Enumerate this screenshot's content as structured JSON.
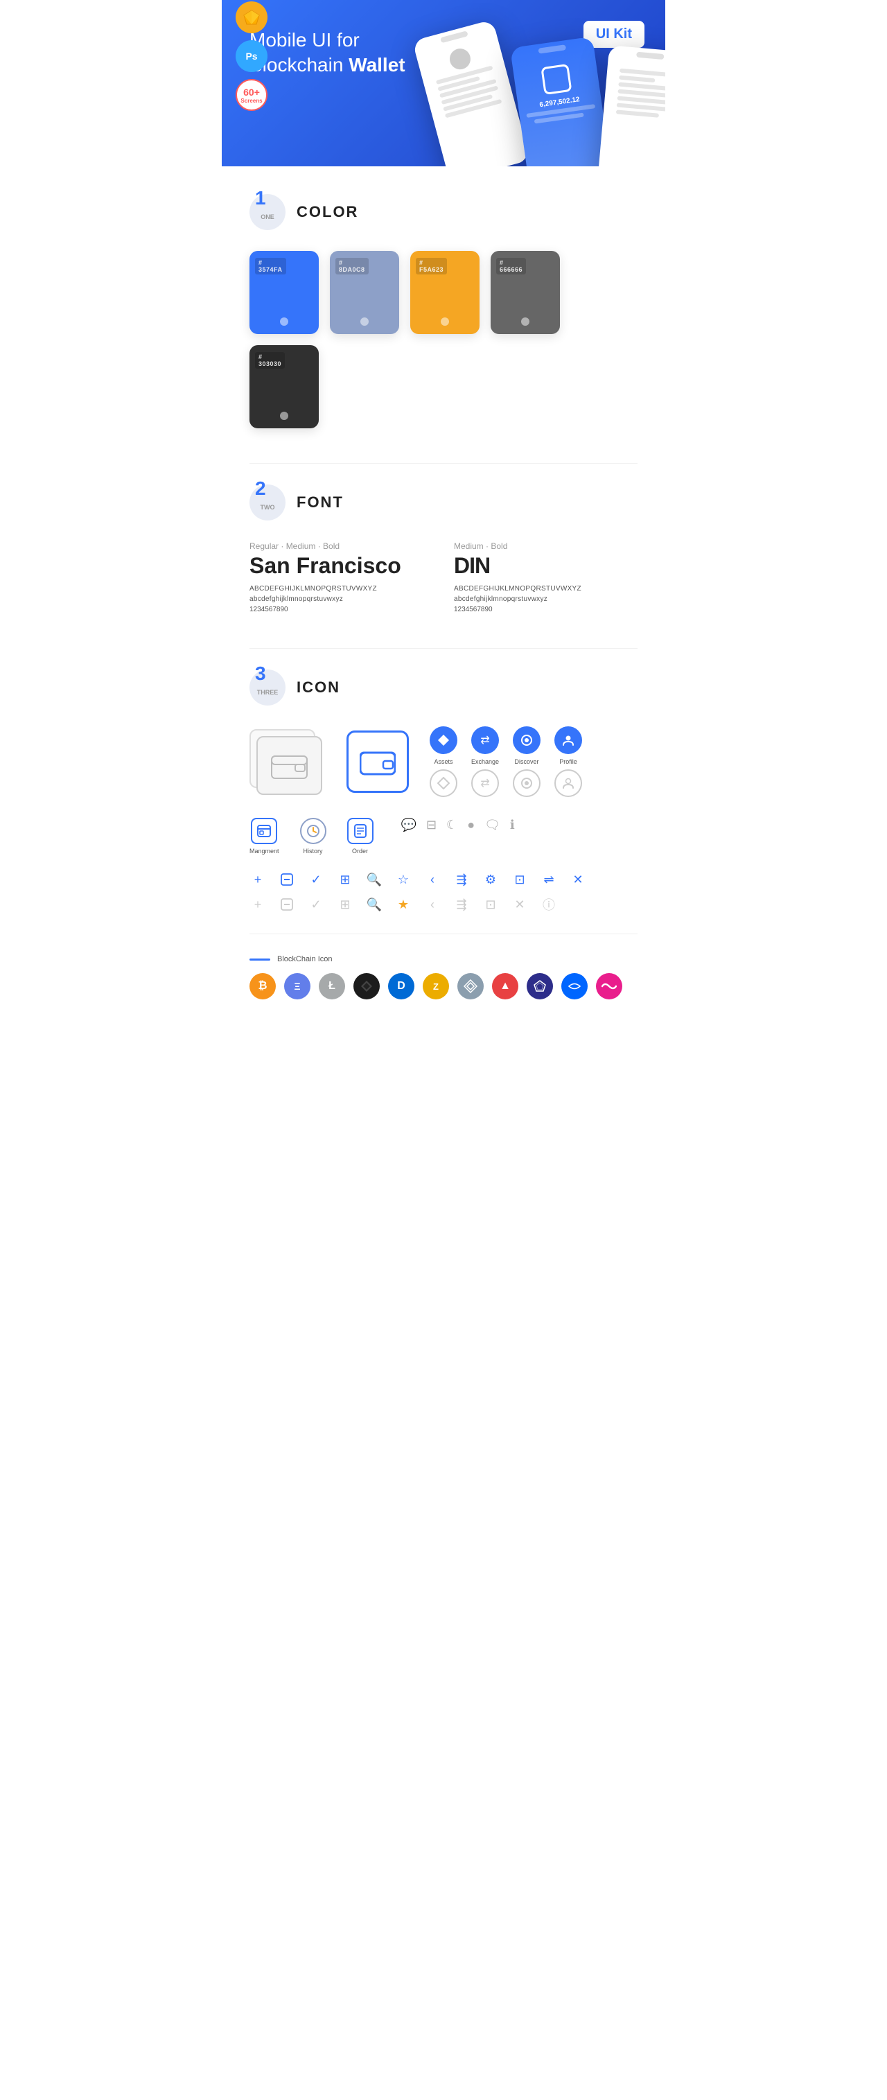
{
  "hero": {
    "title_regular": "Mobile UI for Blockchain ",
    "title_bold": "Wallet",
    "badge": "UI Kit",
    "badges": [
      {
        "id": "sketch",
        "symbol": "⬡",
        "label": "Sketch"
      },
      {
        "id": "ps",
        "symbol": "Ps",
        "label": "Photoshop"
      },
      {
        "id": "screens",
        "num": "60+",
        "label": "Screens"
      }
    ]
  },
  "sections": {
    "color": {
      "number": "1",
      "word": "ONE",
      "title": "COLOR",
      "swatches": [
        {
          "hex": "#3574FA",
          "label": "3574FA",
          "dark_text": false
        },
        {
          "hex": "#8DA0C8",
          "label": "8DA0C8",
          "dark_text": false
        },
        {
          "hex": "#F5A623",
          "label": "F5A623",
          "dark_text": false
        },
        {
          "hex": "#666666",
          "label": "666666",
          "dark_text": false
        },
        {
          "hex": "#303030",
          "label": "303030",
          "dark_text": false
        }
      ]
    },
    "font": {
      "number": "2",
      "word": "TWO",
      "title": "FONT",
      "fonts": [
        {
          "style_label": "Regular · Medium · Bold",
          "name": "San Francisco",
          "chars_upper": "ABCDEFGHIJKLMNOPQRSTUVWXYZ",
          "chars_lower": "abcdefghijklmnopqrstuvwxyz",
          "nums": "1234567890"
        },
        {
          "style_label": "Medium · Bold",
          "name": "DIN",
          "chars_upper": "ABCDEFGHIJKLMNOPQRSTUVWXYZ",
          "chars_lower": "abcdefghijklmnopqrstuvwxyz",
          "nums": "1234567890"
        }
      ]
    },
    "icon": {
      "number": "3",
      "word": "THREE",
      "title": "ICON",
      "nav_icons": [
        {
          "label": "Assets",
          "symbol": "◆"
        },
        {
          "label": "Exchange",
          "symbol": "⇄"
        },
        {
          "label": "Discover",
          "symbol": "●"
        },
        {
          "label": "Profile",
          "symbol": "👤"
        }
      ],
      "bottom_icons": [
        {
          "label": "Mangment",
          "type": "box"
        },
        {
          "label": "History",
          "type": "circle-clock"
        },
        {
          "label": "Order",
          "type": "list"
        }
      ],
      "tool_icons_active": [
        "+",
        "⊟",
        "✓",
        "⊞",
        "🔍",
        "☆",
        "<",
        "<",
        "⚙",
        "⊡",
        "⇌",
        "✕"
      ],
      "tool_icons_inactive": [
        "+",
        "⊟",
        "✓",
        "⊞",
        "🔍",
        "☆",
        "<",
        "<",
        "⊡",
        "✕"
      ],
      "blockchain_label": "BlockChain Icon",
      "crypto": [
        {
          "symbol": "₿",
          "color": "#F7931A",
          "name": "Bitcoin"
        },
        {
          "symbol": "Ξ",
          "color": "#627EEA",
          "name": "Ethereum"
        },
        {
          "symbol": "Ł",
          "color": "#A6A9AA",
          "name": "Litecoin"
        },
        {
          "symbol": "◆",
          "color": "#1C1C1C",
          "name": "BlackCoin"
        },
        {
          "symbol": "D",
          "color": "#006AD5",
          "name": "Dash"
        },
        {
          "symbol": "Z",
          "color": "#ECAC00",
          "name": "Zcash"
        },
        {
          "symbol": "◎",
          "color": "#8B9EAE",
          "name": "Grid"
        },
        {
          "symbol": "▲",
          "color": "#E84142",
          "name": "Avalanche"
        },
        {
          "symbol": "◇",
          "color": "#3B3B98",
          "name": "Crystal"
        },
        {
          "symbol": "∞",
          "color": "#0066FF",
          "name": "Stratis"
        },
        {
          "symbol": "~",
          "color": "#E91E8C",
          "name": "Waves"
        }
      ]
    }
  }
}
